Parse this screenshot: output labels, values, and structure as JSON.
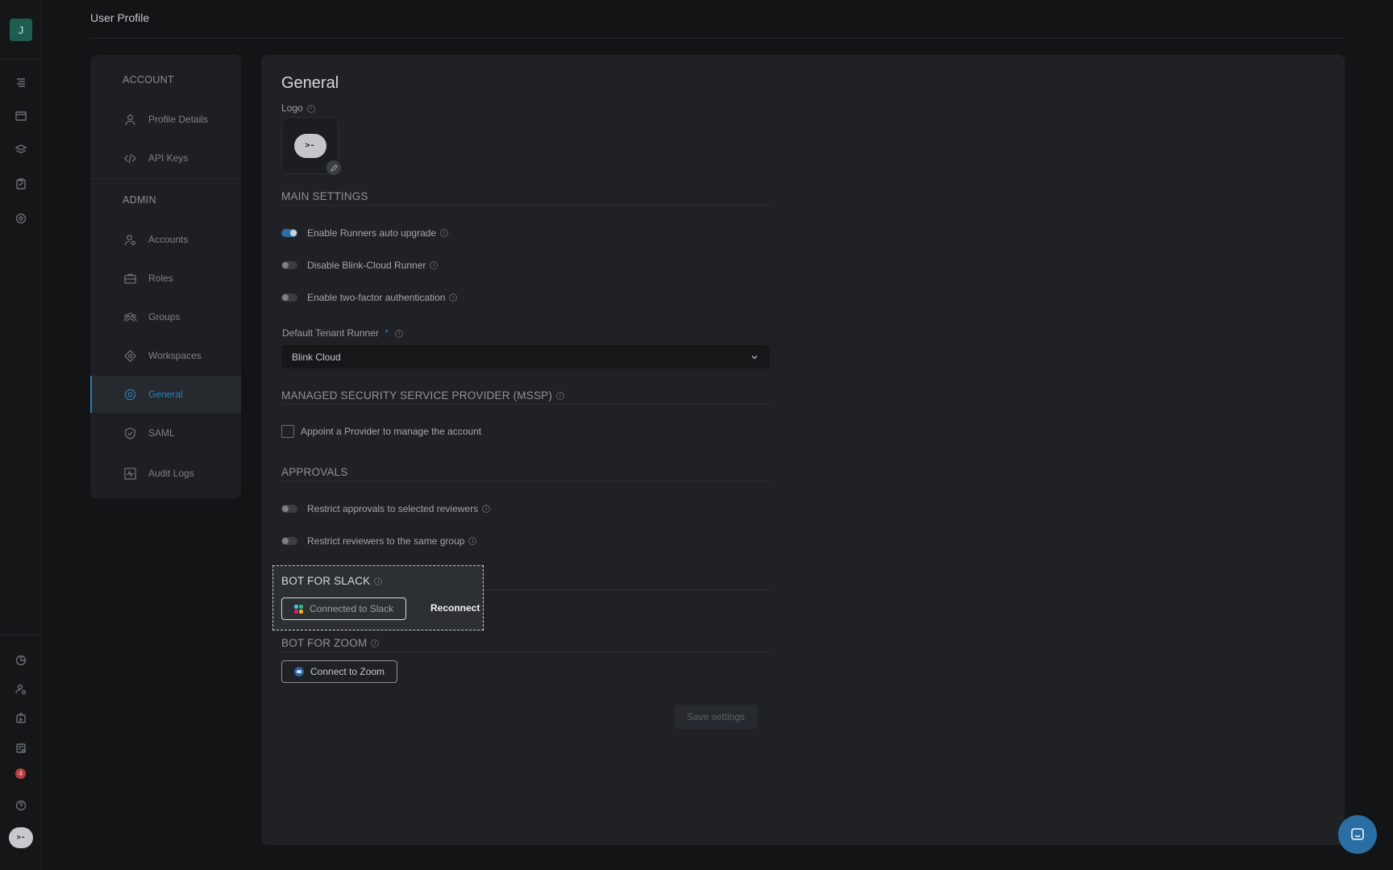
{
  "app": {
    "avatar_initial": "J",
    "page_title": "User Profile",
    "notification_count": "4",
    "bot_logo_glyph": ">-"
  },
  "nav": {
    "account_heading": "ACCOUNT",
    "admin_heading": "ADMIN",
    "items": [
      {
        "label": "Profile Details",
        "icon": "user-icon"
      },
      {
        "label": "API Keys",
        "icon": "code-icon"
      },
      {
        "label": "Accounts",
        "icon": "user-gear-icon"
      },
      {
        "label": "Roles",
        "icon": "briefcase-icon"
      },
      {
        "label": "Groups",
        "icon": "group-icon"
      },
      {
        "label": "Workspaces",
        "icon": "diamond-icon"
      },
      {
        "label": "General",
        "icon": "gear-icon",
        "active": true
      },
      {
        "label": "SAML",
        "icon": "shield-icon"
      },
      {
        "label": "Audit Logs",
        "icon": "activity-icon"
      }
    ]
  },
  "general": {
    "title": "General",
    "logo_label": "Logo",
    "logo_glyph": ">-",
    "main_settings": {
      "title": "MAIN SETTINGS",
      "toggles": [
        {
          "label": "Enable Runners auto upgrade",
          "on": true
        },
        {
          "label": "Disable Blink-Cloud Runner",
          "on": false
        },
        {
          "label": "Enable two-factor authentication",
          "on": false
        }
      ],
      "default_runner_label": "Default Tenant Runner",
      "required_mark": "*",
      "default_runner_value": "Blink Cloud"
    },
    "mssp": {
      "title": "MANAGED SECURITY SERVICE PROVIDER (MSSP)",
      "checkbox_label": "Appoint a Provider to manage the account",
      "checked": false
    },
    "approvals": {
      "title": "APPROVALS",
      "toggles": [
        {
          "label": "Restrict approvals to selected reviewers",
          "on": false
        },
        {
          "label": "Restrict reviewers to the same group",
          "on": false
        }
      ]
    },
    "slack": {
      "title": "BOT FOR SLACK",
      "button_label": "Connected to Slack",
      "reconnect_label": "Reconnect"
    },
    "zoom": {
      "title": "BOT FOR ZOOM",
      "button_label": "Connect to Zoom"
    },
    "save_label": "Save settings"
  },
  "colors": {
    "accent": "#2d7fb8",
    "background": "#121416",
    "panel": "#1f2124",
    "badge": "#b6403f"
  }
}
